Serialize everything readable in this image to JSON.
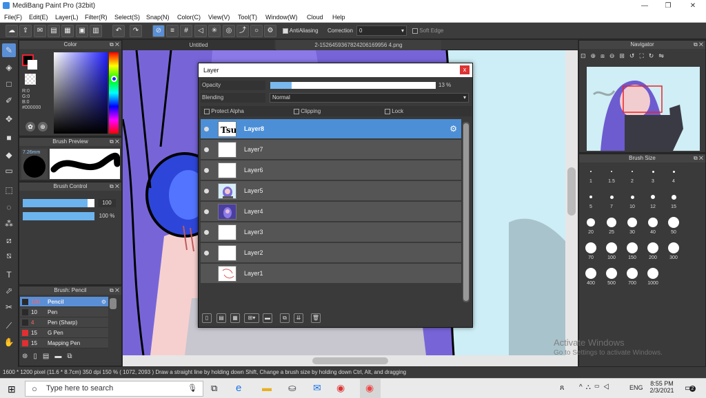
{
  "window": {
    "title": "MediBang Paint Pro (32bit)",
    "minimize": "—",
    "restore": "❐",
    "close": "✕"
  },
  "menu": [
    "File(F)",
    "Edit(E)",
    "Layer(L)",
    "Filter(R)",
    "Select(S)",
    "Snap(N)",
    "Color(C)",
    "View(V)",
    "Tool(T)",
    "Window(W)",
    "Cloud",
    "Help"
  ],
  "toolbar": {
    "antialiasing_label": "AntiAliasing",
    "correction_label": "Correction",
    "correction_value": "0",
    "softedge_label": "Soft Edge"
  },
  "tabs": {
    "untitled": "Untitled",
    "file": "2-1526459367824206169956 4.png"
  },
  "color_panel": {
    "title": "Color",
    "r": "R:0",
    "g": "G:0",
    "b": "B:0",
    "hex": "#000000"
  },
  "brush_preview": {
    "title": "Brush Preview",
    "size": "7.26mm"
  },
  "brush_control": {
    "title": "Brush Control",
    "size_value": "100",
    "opacity_value": "100 %"
  },
  "brush_list": {
    "title": "Brush: Pencil",
    "items": [
      {
        "size": "100",
        "name": "Pencil",
        "color": "#2a2a2a",
        "selected": true
      },
      {
        "size": "10",
        "name": "Pen",
        "color": "#2a2a2a"
      },
      {
        "size": "4",
        "name": "Pen (Sharp)",
        "color": "#2a2a2a"
      },
      {
        "size": "15",
        "name": "G Pen",
        "color": "#e03030"
      },
      {
        "size": "15",
        "name": "Mapping Pen",
        "color": "#e03030"
      }
    ]
  },
  "navigator": {
    "title": "Navigator"
  },
  "brush_size": {
    "title": "Brush Size",
    "sizes": [
      "1",
      "1.5",
      "2",
      "3",
      "4",
      "5",
      "7",
      "10",
      "12",
      "15",
      "20",
      "25",
      "30",
      "40",
      "50",
      "70",
      "100",
      "150",
      "200",
      "300",
      "400",
      "500",
      "700",
      "1000"
    ]
  },
  "layer_dialog": {
    "title": "Layer",
    "close": "x",
    "opacity_label": "Opacity",
    "opacity_value": "13 %",
    "opacity_fraction": 0.13,
    "blending_label": "Blending",
    "blending_value": "Normal",
    "protect_alpha": "Protect Alpha",
    "clipping": "Clipping",
    "lock": "Lock",
    "layers": [
      {
        "name": "Layer8",
        "selected": true,
        "visible": true,
        "thumb": "tsu"
      },
      {
        "name": "Layer7",
        "visible": true,
        "thumb": "blank"
      },
      {
        "name": "Layer6",
        "visible": true,
        "thumb": "blank"
      },
      {
        "name": "Layer5",
        "visible": true,
        "thumb": "girl"
      },
      {
        "name": "Layer4",
        "visible": true,
        "thumb": "purple"
      },
      {
        "name": "Layer3",
        "visible": true,
        "thumb": "blank"
      },
      {
        "name": "Layer2",
        "visible": true,
        "thumb": "blank"
      },
      {
        "name": "Layer1",
        "visible": false,
        "thumb": "sketch"
      }
    ]
  },
  "status": {
    "text": "1600 * 1200 pixel   (11.6 * 8.7cm)   350 dpi   150 %   ( 1072, 2093 )   Draw a straight line by holding down Shift, Change a brush size by holding down Ctrl, Alt, and dragging"
  },
  "watermark": {
    "line1": "Activate Windows",
    "line2": "Go to Settings to activate Windows."
  },
  "taskbar": {
    "search_placeholder": "Type here to search",
    "lang": "ENG",
    "time": "8:55 PM",
    "date": "2/3/2021",
    "notifications": "2"
  }
}
